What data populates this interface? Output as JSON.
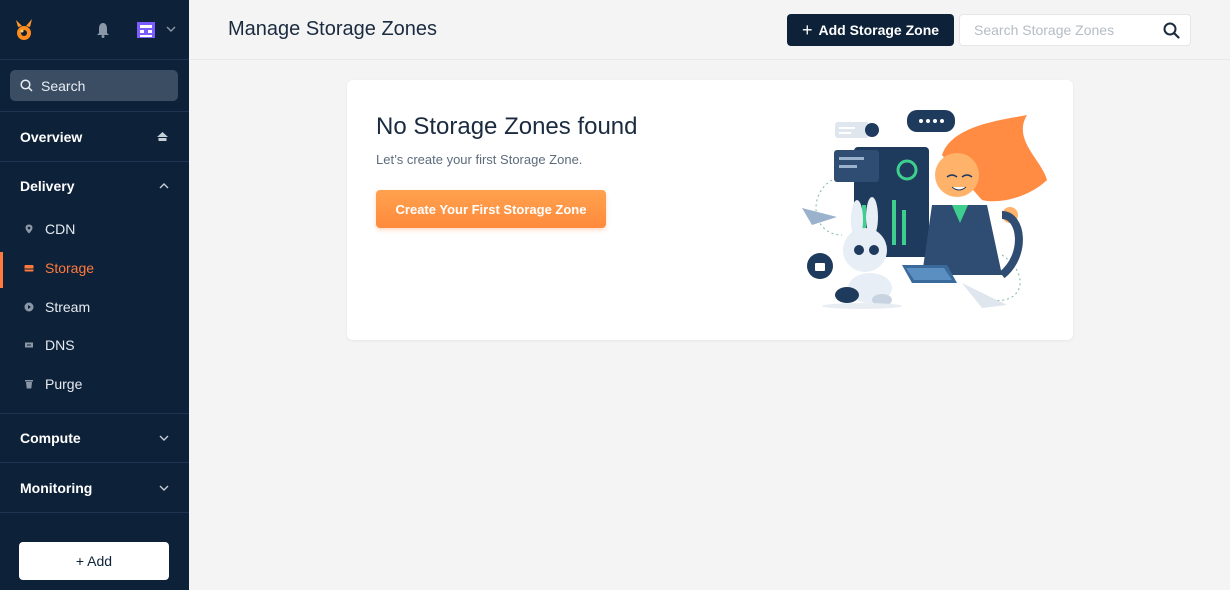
{
  "sidebar": {
    "search_label": "Search",
    "sections": {
      "overview": "Overview",
      "delivery": "Delivery",
      "compute": "Compute",
      "monitoring": "Monitoring"
    },
    "items": [
      {
        "label": "CDN",
        "icon": "location-pin-icon"
      },
      {
        "label": "Storage",
        "icon": "storage-icon",
        "active": true
      },
      {
        "label": "Stream",
        "icon": "play-icon"
      },
      {
        "label": "DNS",
        "icon": "dns-icon"
      },
      {
        "label": "Purge",
        "icon": "trash-icon"
      }
    ],
    "add_label": "+ Add"
  },
  "header": {
    "title": "Manage Storage Zones",
    "add_button": "Add Storage Zone",
    "search_placeholder": "Search Storage Zones"
  },
  "empty_state": {
    "title": "No Storage Zones found",
    "subtitle": "Let’s create your first Storage Zone.",
    "button": "Create Your First Storage Zone"
  },
  "colors": {
    "sidebar_bg": "#0d2138",
    "accent": "#ff7a3c",
    "primary_button": "#0d2138"
  }
}
